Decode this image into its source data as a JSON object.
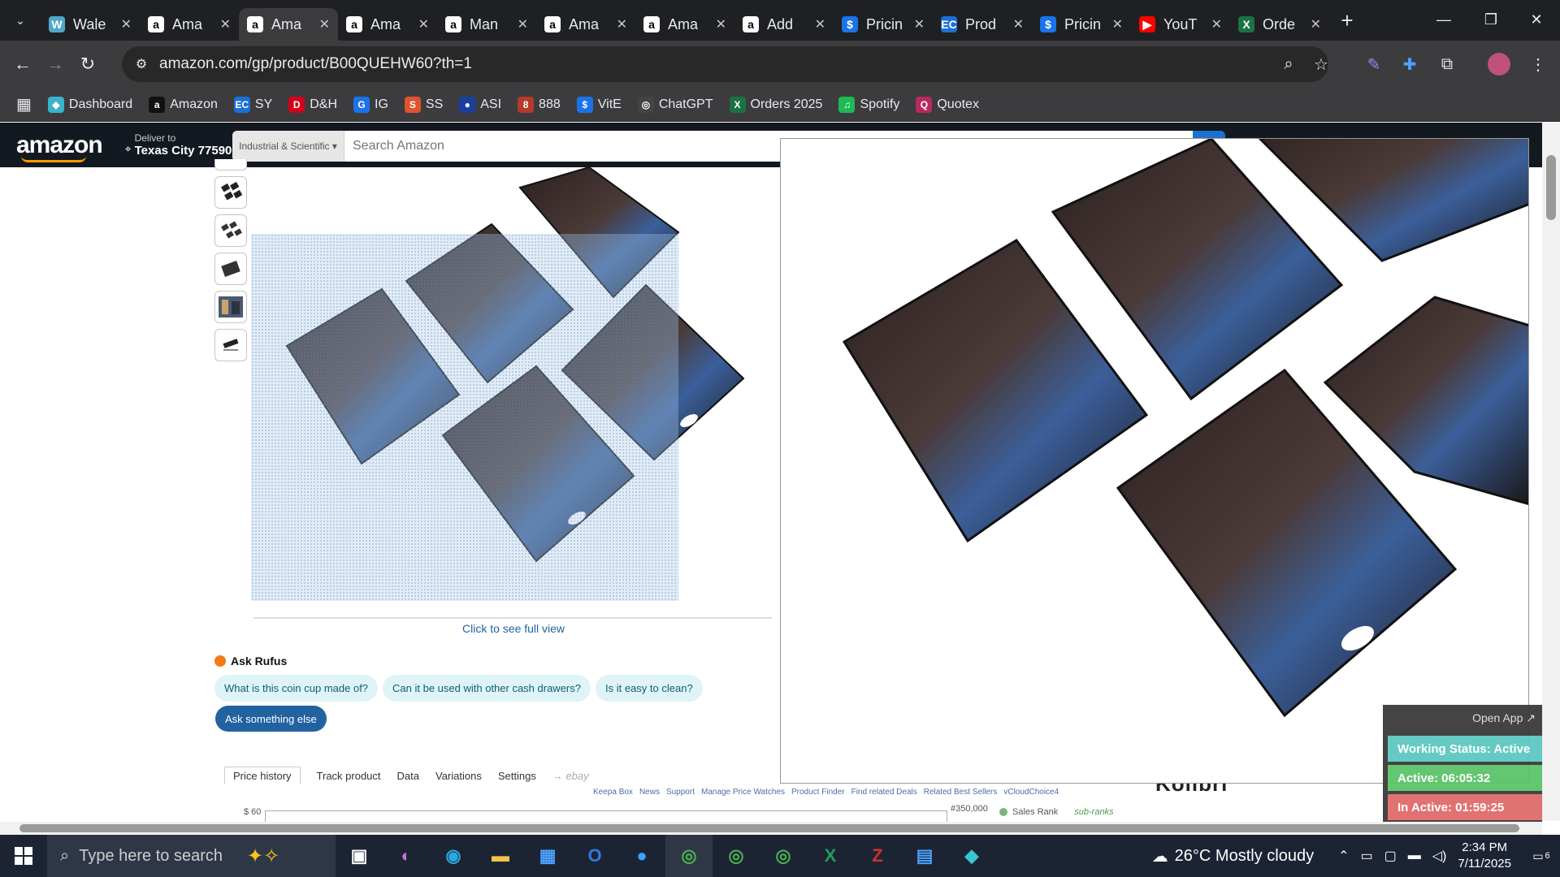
{
  "browser": {
    "tabs": [
      {
        "title": "Wale",
        "icon": "W",
        "color": "#4fa8c8"
      },
      {
        "title": "Ama",
        "icon": "a",
        "color": "#fff"
      },
      {
        "title": "Ama",
        "icon": "a",
        "color": "#fff",
        "active": true
      },
      {
        "title": "Ama",
        "icon": "a",
        "color": "#fff"
      },
      {
        "title": "Man",
        "icon": "a",
        "color": "#000"
      },
      {
        "title": "Ama",
        "icon": "a",
        "color": "#fff"
      },
      {
        "title": "Ama",
        "icon": "a",
        "color": "#000"
      },
      {
        "title": "Add",
        "icon": "a",
        "color": "#000"
      },
      {
        "title": "Pricin",
        "icon": "$",
        "color": "#1a73e8"
      },
      {
        "title": "Prod",
        "icon": "EC",
        "color": "#1c6fd6"
      },
      {
        "title": "Pricin",
        "icon": "$",
        "color": "#1a73e8"
      },
      {
        "title": "YouT",
        "icon": "▶",
        "color": "#ff0000"
      },
      {
        "title": "Orde",
        "icon": "X",
        "color": "#1e7145"
      }
    ],
    "new_tab": "+",
    "url": "amazon.com/gp/product/B00QUEHW60?th=1",
    "bookmarks": [
      {
        "label": "Dashboard",
        "icon": "◆",
        "color": "#3bb3c9"
      },
      {
        "label": "Amazon",
        "icon": "a",
        "color": "#111"
      },
      {
        "label": "SY",
        "icon": "EC",
        "color": "#1c6fd6"
      },
      {
        "label": "D&H",
        "icon": "D",
        "color": "#d0021b"
      },
      {
        "label": "IG",
        "icon": "G",
        "color": "#1a73e8"
      },
      {
        "label": "SS",
        "icon": "S",
        "color": "#e0532f"
      },
      {
        "label": "ASI",
        "icon": "●",
        "color": "#1a3fa0"
      },
      {
        "label": "888",
        "icon": "8",
        "color": "#b43a2a"
      },
      {
        "label": "VitE",
        "icon": "$",
        "color": "#1a73e8"
      },
      {
        "label": "ChatGPT",
        "icon": "◎",
        "color": "#444"
      },
      {
        "label": "Orders 2025",
        "icon": "X",
        "color": "#1e7145"
      },
      {
        "label": "Spotify",
        "icon": "♫",
        "color": "#1db954"
      },
      {
        "label": "Quotex",
        "icon": "Q",
        "color": "#b52b5c"
      }
    ]
  },
  "amazon": {
    "deliver_label": "Deliver to",
    "deliver_location": "Texas City 77590",
    "search_category": "Industrial & Scientific",
    "search_placeholder": "Search Amazon",
    "full_view": "Click to see full view",
    "rufus_title": "Ask Rufus",
    "rufus_chips": [
      "What is this coin cup made of?",
      "Can it be used with other cash drawers?",
      "Is it easy to clean?"
    ],
    "ask_else": "Ask something else"
  },
  "keepa": {
    "tabs": [
      "Price history",
      "Track product",
      "Data",
      "Variations",
      "Settings"
    ],
    "ebay": "→ ebay",
    "links": [
      "Keepa Box",
      "News",
      "Support",
      "Manage Price Watches",
      "Product Finder",
      "Find related Deals",
      "Related Best Sellers",
      "vCloudChoice4"
    ],
    "y_left": "$ 60",
    "y_right": "#350,000",
    "legend": "Sales Rank",
    "subranks": "sub-ranks"
  },
  "kolibri": "Kolibri",
  "tracker": {
    "open_app": "Open App ↗",
    "working_status": "Working Status: Active",
    "active": "Active: 06:05:32",
    "inactive": "In Active: 01:59:25",
    "colors": {
      "status": "#5cc8c0",
      "active": "#5bc46a",
      "inactive": "#e06b6b"
    }
  },
  "taskbar": {
    "search_placeholder": "Type here to search",
    "weather": "26°C  Mostly cloudy",
    "time": "2:34 PM",
    "date": "7/11/2025",
    "notifications": "6"
  }
}
